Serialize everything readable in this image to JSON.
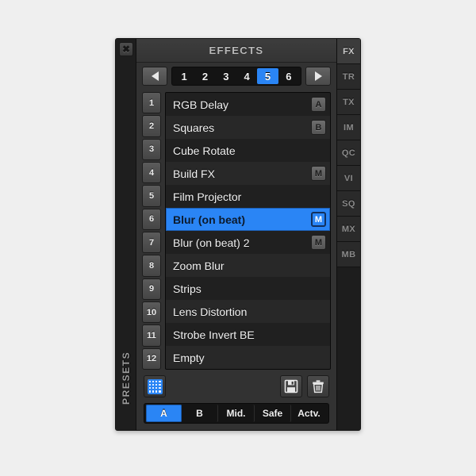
{
  "window": {
    "title": "EFFECTS",
    "close_icon": "close-x-icon",
    "side_label": "PRESETS"
  },
  "colors": {
    "accent_blue": "#2a85f5",
    "panel_bg": "#323232",
    "list_bg": "#1a1a1a",
    "row_dark": "#202020",
    "row_light": "#282828"
  },
  "pager": {
    "prev_icon": "arrow-left-icon",
    "next_icon": "arrow-right-icon",
    "pages": [
      "1",
      "2",
      "3",
      "4",
      "5",
      "6"
    ],
    "active_page": "5"
  },
  "slots": {
    "numbers": [
      "1",
      "2",
      "3",
      "4",
      "5",
      "6",
      "7",
      "8",
      "9",
      "10",
      "11",
      "12"
    ],
    "items": [
      {
        "index": "1",
        "label": "RGB Delay",
        "badge": "A",
        "selected": false
      },
      {
        "index": "2",
        "label": "Squares",
        "badge": "B",
        "selected": false
      },
      {
        "index": "3",
        "label": "Cube Rotate",
        "badge": "",
        "selected": false
      },
      {
        "index": "4",
        "label": "Build FX",
        "badge": "M",
        "selected": false
      },
      {
        "index": "5",
        "label": "Film Projector",
        "badge": "",
        "selected": false
      },
      {
        "index": "6",
        "label": "Blur (on beat)",
        "badge": "M",
        "selected": true
      },
      {
        "index": "7",
        "label": "Blur (on beat) 2",
        "badge": "M",
        "selected": false
      },
      {
        "index": "8",
        "label": "Zoom Blur",
        "badge": "",
        "selected": false
      },
      {
        "index": "9",
        "label": "Strips",
        "badge": "",
        "selected": false
      },
      {
        "index": "10",
        "label": "Lens Distortion",
        "badge": "",
        "selected": false
      },
      {
        "index": "11",
        "label": "Strobe Invert BE",
        "badge": "",
        "selected": false
      },
      {
        "index": "12",
        "label": "Empty",
        "badge": "",
        "selected": false
      }
    ]
  },
  "tools": {
    "grid_icon": "grid-matrix-icon",
    "save_icon": "floppy-save-icon",
    "delete_icon": "trash-delete-icon"
  },
  "modes": {
    "buttons": [
      "A",
      "B",
      "Mid.",
      "Safe",
      "Actv."
    ],
    "active": "A"
  },
  "right_tabs": {
    "items": [
      "FX",
      "TR",
      "TX",
      "IM",
      "QC",
      "VI",
      "SQ",
      "MX",
      "MB"
    ],
    "active": "FX"
  }
}
